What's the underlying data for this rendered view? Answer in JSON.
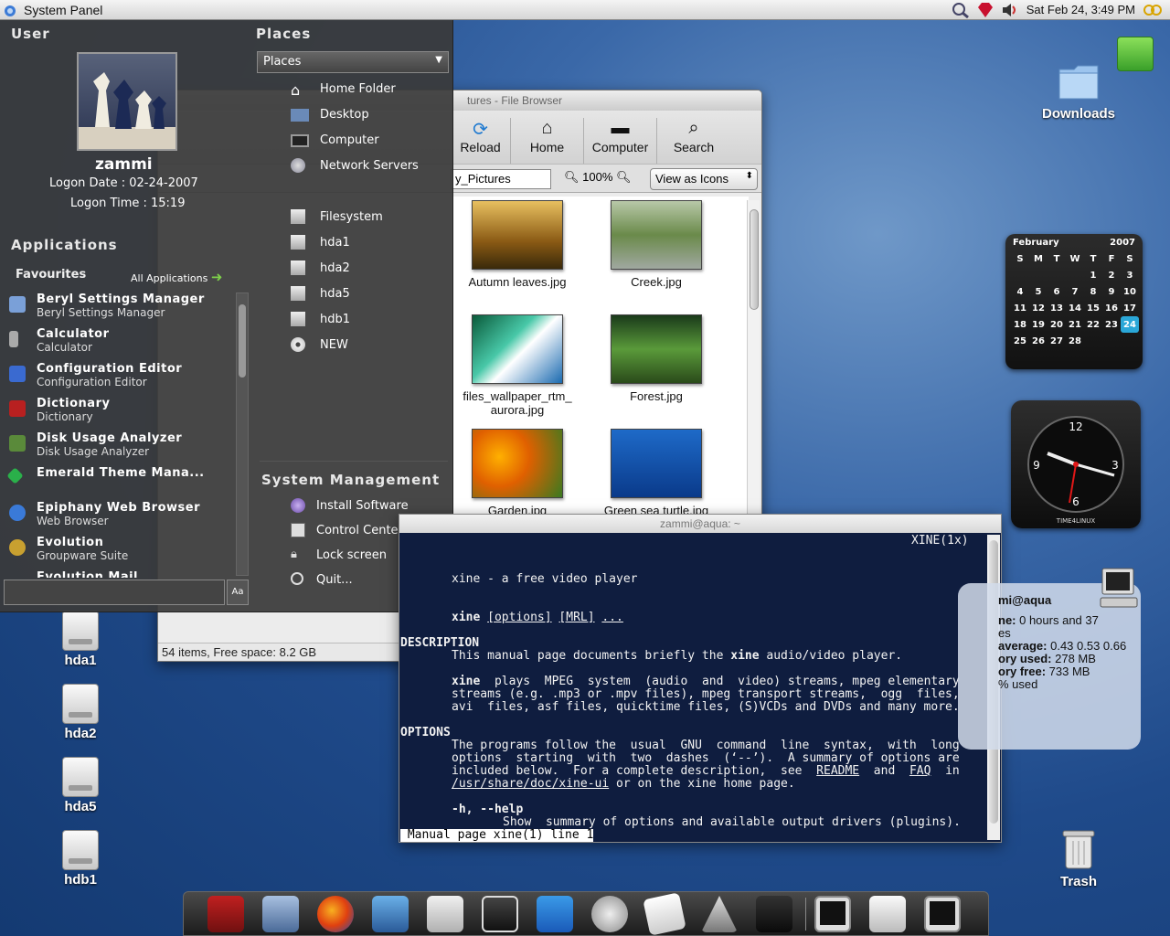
{
  "topbar": {
    "title": "System Panel",
    "datetime": "Sat Feb 24,  3:49 PM"
  },
  "desktop_icons": {
    "downloads": "Downloads",
    "hda1": "hda1",
    "hda2": "hda2",
    "hda5": "hda5",
    "hdb1": "hdb1",
    "trash": "Trash"
  },
  "file_browser": {
    "title": "My_Pictures - File Browser",
    "title_visible": "tures - File Browser",
    "toolbar": [
      "Reload",
      "Home",
      "Computer",
      "Search"
    ],
    "location": "y_Pictures",
    "zoom": "100%",
    "view": "View as Icons",
    "items": [
      "Autumn leaves.jpg",
      "Creek.jpg",
      "files_wallpaper_rtm_",
      "aurora.jpg",
      "Forest.jpg",
      "Garden.jpg",
      "Green sea turtle.jpg"
    ],
    "status": "54 items, Free space: 8.2 GB"
  },
  "menu": {
    "user_header": "User",
    "username": "zammi",
    "logon_date": "Logon Date : 02-24-2007",
    "logon_time": "Logon Time : 15:19",
    "applications_header": "Applications",
    "favourites_label": "Favourites",
    "all_apps": "All Applications",
    "favourites": [
      {
        "name": "Beryl Settings Manager",
        "desc": "Beryl Settings Manager"
      },
      {
        "name": "Calculator",
        "desc": "Calculator"
      },
      {
        "name": "Configuration Editor",
        "desc": "Configuration Editor"
      },
      {
        "name": "Dictionary",
        "desc": "Dictionary"
      },
      {
        "name": "Disk Usage Analyzer",
        "desc": "Disk Usage Analyzer"
      },
      {
        "name": "Emerald Theme Mana...",
        "desc": ""
      },
      {
        "name": "Epiphany Web Browser",
        "desc": "Web Browser"
      },
      {
        "name": "Evolution",
        "desc": "Groupware Suite"
      },
      {
        "name": "Evolution Mail",
        "desc": ""
      }
    ],
    "places_header": "Places",
    "places_select": "Places",
    "places": [
      "Home Folder",
      "Desktop",
      "Computer",
      "Network Servers"
    ],
    "drives": [
      "Filesystem",
      "hda1",
      "hda2",
      "hda5",
      "hdb1",
      "NEW"
    ],
    "sysmgmt_header": "System Management",
    "sysmgmt": [
      "Install Software",
      "Control Center",
      "Lock screen",
      "Quit..."
    ],
    "search_value": ""
  },
  "terminal": {
    "title": "zammi@aqua: ~",
    "header_right": "XINE(1x)",
    "lines": {
      "name": "xine - a free video player",
      "syn_cmd": "xine",
      "syn_opt": "[options]",
      "syn_mrl": "[MRL]",
      "syn_dots": "...",
      "desc_h": "DESCRIPTION",
      "desc1a": "This manual page documents briefly the ",
      "desc1b": "xine",
      "desc1c": " audio/video player.",
      "p2a": "xine",
      "p2b": "  plays  MPEG  system  (audio  and  video) streams, mpeg elementary",
      "p2c": "streams (e.g. .mp3 or .mpv files), mpeg transport streams,  ogg  files,",
      "p2d": "avi  files, asf files, quicktime files, (S)VCDs and DVDs and many more.",
      "opt_h": "OPTIONS",
      "o1": "The programs follow the  usual  GNU  command  line  syntax,  with  long",
      "o2": "options  starting  with  two  dashes  (‘--’).  A summary of options are",
      "o3a": "included below.  For a complete description,  see  ",
      "o3b": "README",
      "o3c": "  and  ",
      "o3d": "FAQ",
      "o3e": "  in",
      "o4a": "/usr/share/doc/xine-ui",
      "o4b": " or on the xine home page.",
      "help": "-h, --help",
      "help_d": "Show  summary of options and available output drivers (plugins).",
      "status": " Manual page xine(1) line 1"
    }
  },
  "calendar": {
    "month": "February",
    "year": "2007",
    "days": [
      "S",
      "M",
      "T",
      "W",
      "T",
      "F",
      "S"
    ],
    "weeks": [
      [
        "",
        "",
        "",
        "",
        "1",
        "2",
        "3"
      ],
      [
        "4",
        "5",
        "6",
        "7",
        "8",
        "9",
        "10"
      ],
      [
        "11",
        "12",
        "13",
        "14",
        "15",
        "16",
        "17"
      ],
      [
        "18",
        "19",
        "20",
        "21",
        "22",
        "23",
        "24"
      ],
      [
        "25",
        "26",
        "27",
        "28",
        "",
        "",
        ""
      ]
    ],
    "today": "24"
  },
  "clock": {
    "n12": "12",
    "n3": "3",
    "n6": "6",
    "n9": "9",
    "brand": "TIME4LINUX"
  },
  "sysinfo": {
    "host": "mi@aqua",
    "l1a": "ne:",
    "l1b": " 0 hours and 37",
    "l2": "es",
    "l3a": "average:",
    "l3b": " 0.43 0.53 0.66",
    "l4a": "ory used:",
    "l4b": " 278 MB",
    "l5a": "ory free:",
    "l5b": " 733 MB",
    "l6": "% used"
  },
  "colors": {
    "accent_today": "#2aa7d8",
    "terminal_bg": "#0f1d3f",
    "menu_bg": "#3a3a3a"
  }
}
